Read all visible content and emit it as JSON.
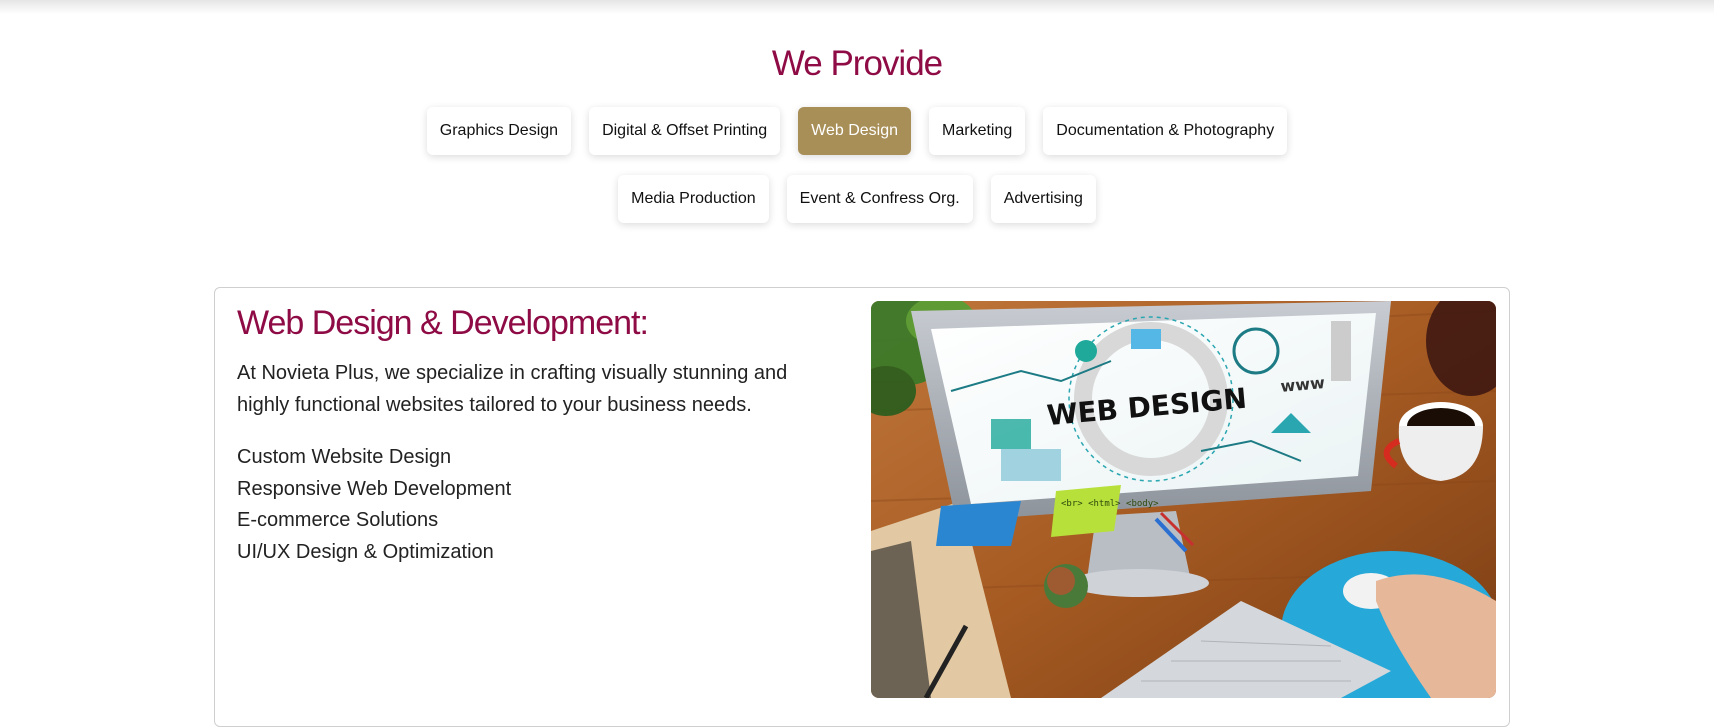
{
  "section": {
    "title": "We Provide"
  },
  "tabs": [
    {
      "label": "Graphics Design",
      "active": false
    },
    {
      "label": "Digital & Offset Printing",
      "active": false
    },
    {
      "label": "Web Design",
      "active": true
    },
    {
      "label": "Marketing",
      "active": false
    },
    {
      "label": "Documentation & Photography",
      "active": false
    },
    {
      "label": "Media Production",
      "active": false
    },
    {
      "label": "Event & Confress Org.",
      "active": false
    },
    {
      "label": "Advertising",
      "active": false
    }
  ],
  "panel": {
    "title": "Web Design & Development:",
    "description": "At Novieta Plus, we specialize in crafting visually stunning and highly functional websites tailored to your business needs.",
    "features": [
      "Custom Website Design",
      "Responsive Web Development",
      "E-commerce Solutions",
      "UI/UX Design & Optimization"
    ],
    "image": {
      "screen_text": "WEB DESIGN",
      "www_text": "www",
      "note_text": "<br> <html> <body>"
    }
  },
  "colors": {
    "heading": "#8e0b45",
    "active_tab": "#a88e57",
    "tab_text": "#111111"
  }
}
